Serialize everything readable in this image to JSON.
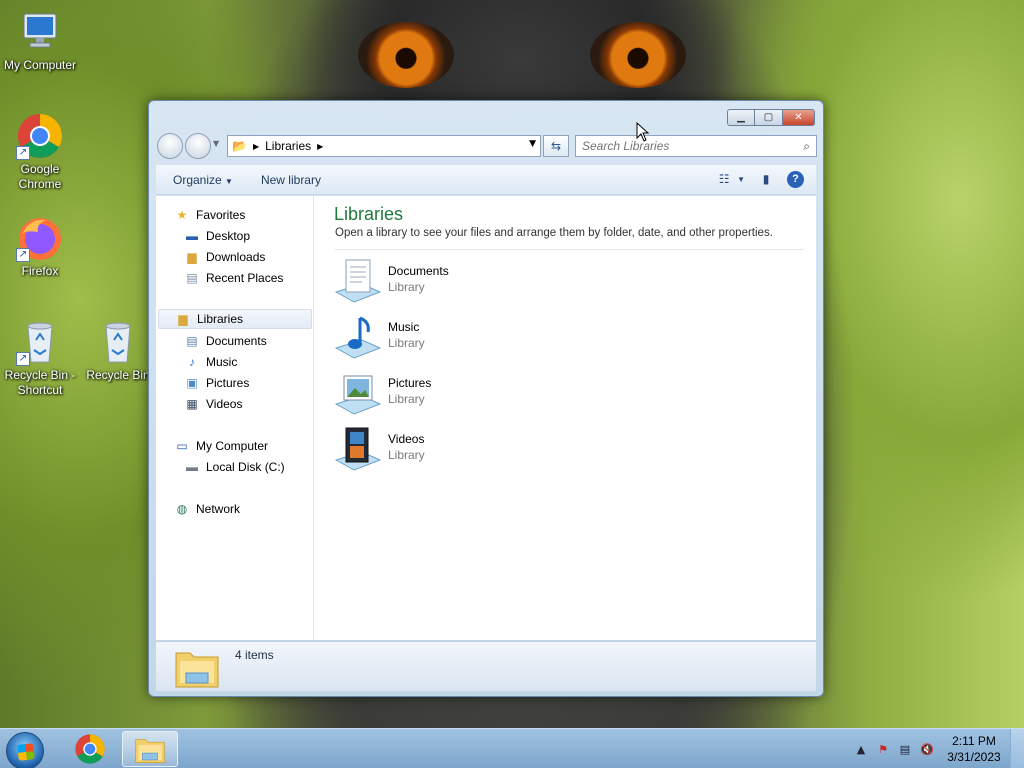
{
  "desktop": {
    "icons": [
      {
        "label": "My Computer",
        "icon": "computer-icon"
      },
      {
        "label": "Google Chrome",
        "icon": "chrome-icon"
      },
      {
        "label": "Firefox",
        "icon": "firefox-icon"
      },
      {
        "label": "Recycle Bin - Shortcut",
        "icon": "recycle-bin-icon"
      },
      {
        "label": "Recycle Bin",
        "icon": "recycle-bin-icon"
      }
    ]
  },
  "window": {
    "address": {
      "crumb": "Libraries"
    },
    "search": {
      "placeholder": "Search Libraries"
    },
    "toolbar": {
      "organize": "Organize",
      "new_library": "New library"
    },
    "nav_pane": {
      "favorites": "Favorites",
      "desktop": "Desktop",
      "downloads": "Downloads",
      "recent_places": "Recent Places",
      "libraries": "Libraries",
      "documents": "Documents",
      "music": "Music",
      "pictures": "Pictures",
      "videos": "Videos",
      "my_computer": "My Computer",
      "local_disk": "Local Disk (C:)",
      "network": "Network"
    },
    "content": {
      "title": "Libraries",
      "description": "Open a library to see your files and arrange them by folder, date, and other properties.",
      "items": [
        {
          "name": "Documents",
          "type": "Library",
          "icon": "documents-library-icon"
        },
        {
          "name": "Music",
          "type": "Library",
          "icon": "music-library-icon"
        },
        {
          "name": "Pictures",
          "type": "Library",
          "icon": "pictures-library-icon"
        },
        {
          "name": "Videos",
          "type": "Library",
          "icon": "videos-library-icon"
        }
      ]
    },
    "details": {
      "count": "4 items"
    }
  },
  "taskbar": {
    "clock_time": "2:11 PM",
    "clock_date": "3/31/2023",
    "colors": {
      "accent": "#1e7a3a",
      "taskbar": "#8fb4d8"
    }
  }
}
